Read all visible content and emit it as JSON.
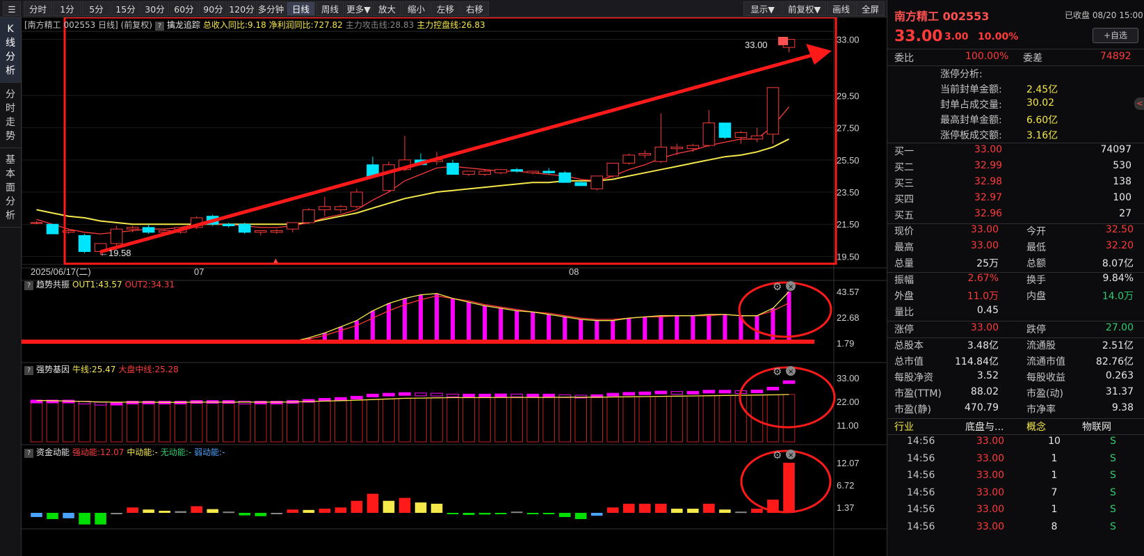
{
  "toolbar": {
    "items": [
      "分时",
      "1分",
      "5分",
      "15分",
      "30分",
      "60分",
      "90分",
      "120分",
      "多分钟",
      "日线",
      "周线",
      "更多▼",
      "放大",
      "缩小",
      "左移",
      "右移"
    ],
    "active": "日线",
    "right_items": [
      "显示▼",
      "前复权▼",
      "画线",
      "全屏"
    ]
  },
  "leftnav": [
    {
      "label": "K线分析",
      "active": true
    },
    {
      "label": "分时走势",
      "active": false
    },
    {
      "label": "基本面分析",
      "active": false
    }
  ],
  "main": {
    "title": "[南方精工 002553 日线] (前复权)",
    "indicator": "擒龙追踪",
    "params": [
      {
        "label": "总收入同比:9.18",
        "color": "#f5e84a"
      },
      {
        "label": "净利润同比:727.82",
        "color": "#f5e84a"
      },
      {
        "label": "主力攻击线:28.83",
        "color": "#888888"
      },
      {
        "label": "主力控盘线:26.83",
        "color": "#f5e84a"
      }
    ],
    "y_ticks": [
      "33.00",
      "29.50",
      "27.50",
      "25.50",
      "23.50",
      "21.50",
      "19.50"
    ],
    "x_labels": [
      "2025/06/17(二)",
      "07",
      "08"
    ],
    "high_label": "33.00",
    "low_label": "19.58"
  },
  "panel2": {
    "name": "趋势共振",
    "params": [
      {
        "label": "OUT1:43.57",
        "color": "#f5e84a"
      },
      {
        "label": "OUT2:34.31",
        "color": "#ff3b3b"
      }
    ],
    "y_ticks": [
      "43.57",
      "22.68",
      "1.79"
    ]
  },
  "panel3": {
    "name": "强势基因",
    "params": [
      {
        "label": "牛线:25.47",
        "color": "#f5e84a"
      },
      {
        "label": "大盘中线:25.28",
        "color": "#ff3b3b"
      }
    ],
    "y_ticks": [
      "33.00",
      "22.00",
      "11.00"
    ]
  },
  "panel4": {
    "name": "资金动能",
    "params": [
      {
        "label": "强动能:12.07",
        "color": "#ff3b3b"
      },
      {
        "label": "中动能:-",
        "color": "#f5e84a"
      },
      {
        "label": "无动能:-",
        "color": "#2ecc71"
      },
      {
        "label": "弱动能:-",
        "color": "#4aa3ff"
      }
    ],
    "y_ticks": [
      "12.07",
      "6.72",
      "1.37"
    ]
  },
  "chart_data": {
    "type": "candlestick",
    "title": "南方精工 002553 日线",
    "candles": [
      [
        21.6,
        21.7,
        21.5,
        21.6
      ],
      [
        21.5,
        21.5,
        20.9,
        20.9
      ],
      [
        21.0,
        21.2,
        20.9,
        21.1
      ],
      [
        20.8,
        20.9,
        19.7,
        19.8
      ],
      [
        19.8,
        20.0,
        19.58,
        20.3
      ],
      [
        20.3,
        21.4,
        20.1,
        21.2
      ],
      [
        21.2,
        21.4,
        21.0,
        21.3
      ],
      [
        21.3,
        21.5,
        20.9,
        21.0
      ],
      [
        21.0,
        21.2,
        20.9,
        21.1
      ],
      [
        21.0,
        21.3,
        20.9,
        21.3
      ],
      [
        21.3,
        22.0,
        21.2,
        21.9
      ],
      [
        22.0,
        22.1,
        21.4,
        21.5
      ],
      [
        21.5,
        21.6,
        21.3,
        21.4
      ],
      [
        21.5,
        21.6,
        20.9,
        21.0
      ],
      [
        21.0,
        21.1,
        20.8,
        21.1
      ],
      [
        21.0,
        21.2,
        20.9,
        21.1
      ],
      [
        21.2,
        21.6,
        21.0,
        21.6
      ],
      [
        21.6,
        22.5,
        21.5,
        22.4
      ],
      [
        22.4,
        23.2,
        22.0,
        22.6
      ],
      [
        22.4,
        22.7,
        22.2,
        22.6
      ],
      [
        22.6,
        23.7,
        22.5,
        23.5
      ],
      [
        25.2,
        25.7,
        24.4,
        24.5
      ],
      [
        23.6,
        25.4,
        23.5,
        25.2
      ],
      [
        24.9,
        27.0,
        24.8,
        25.5
      ],
      [
        25.5,
        25.9,
        25.3,
        25.2
      ],
      [
        25.4,
        26.0,
        25.2,
        25.5
      ],
      [
        25.3,
        25.5,
        24.6,
        24.6
      ],
      [
        24.6,
        24.8,
        24.5,
        24.8
      ],
      [
        24.6,
        24.9,
        24.5,
        24.8
      ],
      [
        24.7,
        24.9,
        24.6,
        24.9
      ],
      [
        24.9,
        25.0,
        24.7,
        24.8
      ],
      [
        24.7,
        24.8,
        24.6,
        24.8
      ],
      [
        24.8,
        25.0,
        24.6,
        24.7
      ],
      [
        24.7,
        24.8,
        24.1,
        24.1
      ],
      [
        24.1,
        24.2,
        23.9,
        23.9
      ],
      [
        23.7,
        24.5,
        23.6,
        24.5
      ],
      [
        24.5,
        25.3,
        24.4,
        25.3
      ],
      [
        25.3,
        25.9,
        25.2,
        25.8
      ],
      [
        25.8,
        26.1,
        25.6,
        25.9
      ],
      [
        25.4,
        28.4,
        25.3,
        26.3
      ],
      [
        26.2,
        26.5,
        25.8,
        26.3
      ],
      [
        26.2,
        26.5,
        26.0,
        26.4
      ],
      [
        26.4,
        28.6,
        26.3,
        27.8
      ],
      [
        27.8,
        27.8,
        26.8,
        26.9
      ],
      [
        26.9,
        27.3,
        26.5,
        27.2
      ],
      [
        26.8,
        27.5,
        26.6,
        27.0
      ],
      [
        27.1,
        30.0,
        26.5,
        30.0
      ],
      [
        32.5,
        33.0,
        32.2,
        33.0
      ]
    ],
    "ma_fast": [
      21.8,
      21.5,
      21.2,
      21.0,
      20.9,
      21.0,
      21.1,
      21.2,
      21.2,
      21.3,
      21.5,
      21.5,
      21.5,
      21.4,
      21.3,
      21.3,
      21.4,
      21.6,
      21.9,
      22.1,
      22.4,
      23.0,
      23.5,
      24.2,
      24.6,
      25.0,
      25.1,
      25.0,
      24.9,
      24.8,
      24.8,
      24.7,
      24.6,
      24.5,
      24.3,
      24.2,
      24.5,
      24.9,
      25.2,
      25.6,
      25.9,
      26.1,
      26.4,
      26.6,
      26.8,
      26.8,
      27.6,
      28.8
    ],
    "ma_slow": [
      22.4,
      22.2,
      22.0,
      21.9,
      21.7,
      21.6,
      21.5,
      21.5,
      21.5,
      21.5,
      21.5,
      21.5,
      21.5,
      21.5,
      21.5,
      21.5,
      21.5,
      21.6,
      21.8,
      22.0,
      22.2,
      22.5,
      22.8,
      23.1,
      23.3,
      23.5,
      23.6,
      23.7,
      23.8,
      23.9,
      24.0,
      24.1,
      24.1,
      24.2,
      24.2,
      24.2,
      24.3,
      24.5,
      24.7,
      24.9,
      25.1,
      25.3,
      25.5,
      25.7,
      25.8,
      26.0,
      26.3,
      26.8
    ],
    "panel2": {
      "out1": [
        1.79,
        1.79,
        1.79,
        1.79,
        1.79,
        1.79,
        1.79,
        1.79,
        1.79,
        1.79,
        1.79,
        1.79,
        1.79,
        1.79,
        1.79,
        1.79,
        3,
        6,
        10,
        15,
        20,
        28,
        34,
        38,
        41,
        42,
        38,
        35,
        32,
        30,
        28,
        27,
        25,
        23,
        21,
        20,
        20,
        22,
        23,
        24,
        24,
        24,
        25,
        25,
        24,
        24,
        30,
        43.57
      ],
      "out2": [
        1.79,
        1.79,
        1.79,
        1.79,
        1.79,
        1.79,
        1.79,
        1.79,
        1.79,
        1.79,
        1.79,
        1.79,
        1.79,
        1.79,
        1.79,
        1.79,
        2.5,
        5,
        8,
        12,
        16,
        22,
        28,
        33,
        37,
        40,
        38,
        36,
        33,
        31,
        29,
        27,
        26,
        24,
        22,
        21,
        21,
        22,
        23,
        23,
        24,
        24,
        24,
        25,
        24,
        24,
        28,
        34.31
      ]
    },
    "panel3": {
      "bull": [
        22,
        22,
        22,
        21.5,
        21,
        21,
        21.5,
        21.5,
        21.5,
        21.5,
        21.8,
        21.8,
        21.8,
        21.5,
        21.5,
        21.5,
        21.8,
        22.3,
        22.8,
        23.2,
        23.8,
        24.8,
        25.2,
        25.5,
        25.3,
        25.2,
        24.8,
        24.8,
        24.8,
        24.9,
        24.8,
        24.8,
        24.8,
        24.5,
        24.3,
        24.5,
        25.2,
        25.6,
        25.8,
        26.2,
        26.0,
        26.1,
        26.6,
        26.6,
        26.4,
        26.7,
        28.0,
        31.0
      ],
      "mid": [
        22.5,
        22.4,
        22.2,
        22.0,
        21.8,
        21.7,
        21.7,
        21.7,
        21.6,
        21.6,
        21.7,
        21.7,
        21.7,
        21.7,
        21.7,
        21.7,
        21.8,
        22.0,
        22.2,
        22.4,
        22.6,
        22.9,
        23.2,
        23.5,
        23.6,
        23.7,
        23.8,
        23.8,
        23.8,
        23.9,
        23.9,
        23.9,
        23.9,
        24.0,
        24.0,
        24.0,
        24.1,
        24.2,
        24.3,
        24.4,
        24.5,
        24.6,
        24.7,
        24.8,
        24.9,
        25.0,
        25.1,
        25.28
      ]
    },
    "panel4": {
      "values": [
        -1.0,
        -1.5,
        -1.3,
        -2.8,
        -2.8,
        0,
        1.3,
        0.8,
        0.5,
        0.4,
        1.6,
        0.9,
        0.3,
        -0.6,
        -0.8,
        0,
        0.8,
        0.7,
        1.0,
        1.3,
        2.9,
        4.6,
        2.9,
        3.6,
        2.5,
        2.2,
        -0.3,
        -0.5,
        -0.4,
        -0.3,
        0.3,
        -0.3,
        -0.3,
        -1.0,
        -1.5,
        -0.7,
        1.3,
        2.2,
        2.2,
        2.2,
        1.0,
        1.0,
        2.2,
        0.8,
        0.3,
        1.0,
        3.2,
        12.07
      ],
      "colors": [
        "blue",
        "green",
        "blue",
        "green",
        "green",
        "gray",
        "red",
        "yellow",
        "yellow",
        "gray",
        "red",
        "yellow",
        "gray",
        "green",
        "green",
        "gray",
        "red",
        "yellow",
        "red",
        "red",
        "red",
        "red",
        "yellow",
        "red",
        "yellow",
        "yellow",
        "green",
        "green",
        "green",
        "green",
        "gray",
        "green",
        "green",
        "green",
        "green",
        "blue",
        "red",
        "red",
        "red",
        "red",
        "yellow",
        "yellow",
        "red",
        "yellow",
        "gray",
        "red",
        "red",
        "red"
      ]
    },
    "y_range": [
      19.0,
      33.5
    ]
  },
  "quote": {
    "name": "南方精工 002553",
    "status": "已收盘 08/20 15:00",
    "price": "33.00",
    "change": "3.00",
    "pct": "10.00%",
    "fav": "+自选",
    "weibi_label": "委比",
    "weibi": "100.00%",
    "weicha_label": "委差",
    "weicha": "74892",
    "limit_title": "涨停分析:",
    "limit_rows": [
      {
        "label": "当前封单金额:",
        "value": "2.45亿"
      },
      {
        "label": "封单占成交量:",
        "value": "30.02"
      },
      {
        "label": "最高封单金额:",
        "value": "6.60亿"
      },
      {
        "label": "涨停板成交额:",
        "value": "3.16亿"
      }
    ],
    "bids": [
      {
        "label": "买一",
        "price": "33.00",
        "vol": "74097"
      },
      {
        "label": "买二",
        "price": "32.99",
        "vol": "530"
      },
      {
        "label": "买三",
        "price": "32.98",
        "vol": "138"
      },
      {
        "label": "买四",
        "price": "32.97",
        "vol": "100"
      },
      {
        "label": "买五",
        "price": "32.96",
        "vol": "27"
      }
    ],
    "stats": [
      [
        {
          "label": "现价",
          "value": "33.00",
          "color": "red"
        },
        {
          "label": "今开",
          "value": "32.50",
          "color": "red"
        }
      ],
      [
        {
          "label": "最高",
          "value": "33.00",
          "color": "red"
        },
        {
          "label": "最低",
          "value": "32.20",
          "color": "red"
        }
      ],
      [
        {
          "label": "总量",
          "value": "25万",
          "color": "wht"
        },
        {
          "label": "总额",
          "value": "8.07亿",
          "color": "wht"
        }
      ]
    ],
    "stats2": [
      [
        {
          "label": "振幅",
          "value": "2.67%",
          "color": "red"
        },
        {
          "label": "换手",
          "value": "9.84%",
          "color": "wht"
        }
      ],
      [
        {
          "label": "外盘",
          "value": "11.0万",
          "color": "red"
        },
        {
          "label": "内盘",
          "value": "14.0万",
          "color": "grn"
        }
      ],
      [
        {
          "label": "量比",
          "value": "0.45",
          "color": "wht"
        }
      ]
    ],
    "limits": [
      {
        "label": "涨停",
        "value": "33.00",
        "color": "red"
      },
      {
        "label": "跌停",
        "value": "27.00",
        "color": "grn"
      }
    ],
    "fund": [
      [
        {
          "label": "总股本",
          "value": "3.48亿"
        },
        {
          "label": "流通股",
          "value": "2.51亿"
        }
      ],
      [
        {
          "label": "总市值",
          "value": "114.84亿"
        },
        {
          "label": "流通市值",
          "value": "82.76亿"
        }
      ],
      [
        {
          "label": "每股净资",
          "value": "3.52"
        },
        {
          "label": "每股收益",
          "value": "0.263"
        }
      ],
      [
        {
          "label": "市盈(TTM)",
          "value": "88.02"
        },
        {
          "label": "市盈(动)",
          "value": "31.37"
        }
      ],
      [
        {
          "label": "市盈(静)",
          "value": "470.79"
        },
        {
          "label": "市净率",
          "value": "9.38"
        }
      ]
    ],
    "tabs": [
      "行业",
      "底盘与...",
      "概念",
      "物联网"
    ],
    "ticks": [
      {
        "time": "14:56",
        "price": "33.00",
        "vol": "10",
        "side": "S"
      },
      {
        "time": "14:56",
        "price": "33.00",
        "vol": "1",
        "side": "S"
      },
      {
        "time": "14:56",
        "price": "33.00",
        "vol": "1",
        "side": "S"
      },
      {
        "time": "14:56",
        "price": "33.00",
        "vol": "7",
        "side": "S"
      },
      {
        "time": "14:56",
        "price": "33.00",
        "vol": "1",
        "side": "S"
      },
      {
        "time": "14:56",
        "price": "33.00",
        "vol": "8",
        "side": "S"
      }
    ]
  }
}
